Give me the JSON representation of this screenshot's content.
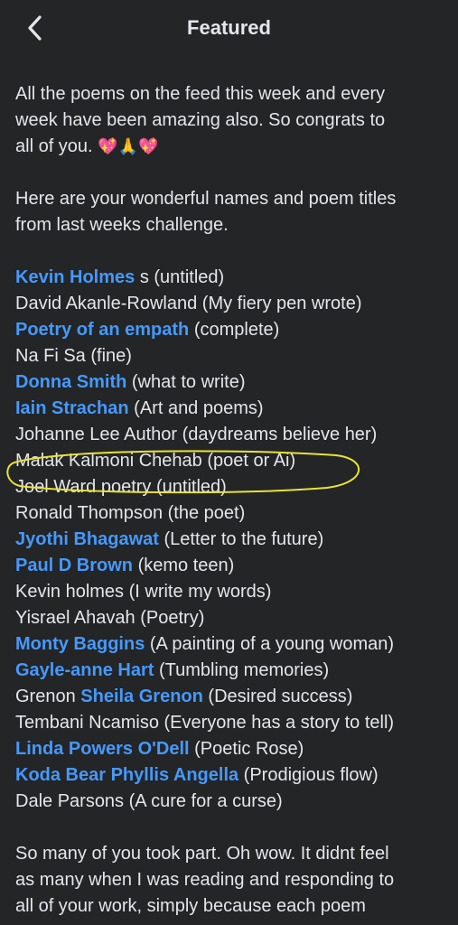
{
  "header": {
    "title": "Featured"
  },
  "intro": {
    "line1": "All the poems on the feed this week and every",
    "line2": "week have been amazing also. So congrats to",
    "line3": "all of you.",
    "emojis": "💖🙏💖"
  },
  "names_intro": {
    "line1": "Here are your wonderful names and poem titles",
    "line2": "from last weeks challenge."
  },
  "entries": [
    {
      "tag1": "Kevin Holmes",
      "text": " s (untitled)"
    },
    {
      "text": "David Akanle-Rowland (My fiery pen wrote)"
    },
    {
      "tag1": "Poetry of an empath",
      "text": "  (complete)"
    },
    {
      "text": "Na Fi Sa (fine)"
    },
    {
      "tag1": "Donna Smith",
      "text": " (what to write)"
    },
    {
      "tag1": "Iain Strachan",
      "text": "  (Art and poems)"
    },
    {
      "text": "Johanne Lee Author (daydreams believe her)"
    },
    {
      "text": "Malak Kalmoni Chehab (poet or Ai)"
    },
    {
      "text": "Joel Ward poetry (untitled)"
    },
    {
      "text": "Ronald Thompson (the poet)"
    },
    {
      "tag1": "Jyothi Bhagawat",
      "text": " (Letter to the future)"
    },
    {
      "tag1": "Paul D Brown",
      "text": "  (kemo teen)"
    },
    {
      "text": "Kevin holmes (I write my words)"
    },
    {
      "text": "Yisrael Ahavah (Poetry)"
    },
    {
      "tag1": "Monty Baggins",
      "text": "  (A painting of a young woman)"
    },
    {
      "tag1": "Gayle-anne Hart",
      "text": "  (Tumbling memories)"
    },
    {
      "prefix": "Grenon ",
      "tag1": "Sheila Grenon",
      "text": "  (Desired success)"
    },
    {
      "text": "Tembani Ncamiso (Everyone has a story to tell)"
    },
    {
      "tag1": "Linda Powers O'Dell",
      "text": "  (Poetic Rose)"
    },
    {
      "prefix": " ",
      "tag1": "Koda Bear",
      "mid": "  ",
      "tag2": "Phyllis Angella",
      "text": "  (Prodigious flow)"
    },
    {
      "text": "Dale Parsons (A cure for a curse)"
    }
  ],
  "outro": {
    "line1": "So many of you took part. Oh wow. It didnt feel",
    "line2": "as many when I was reading and responding to",
    "line3": "all of your work, simply because each poem"
  },
  "colors": {
    "background": "#242526",
    "text": "#e4e6eb",
    "tag": "#4599ff",
    "highlight": "#e8e23a"
  }
}
